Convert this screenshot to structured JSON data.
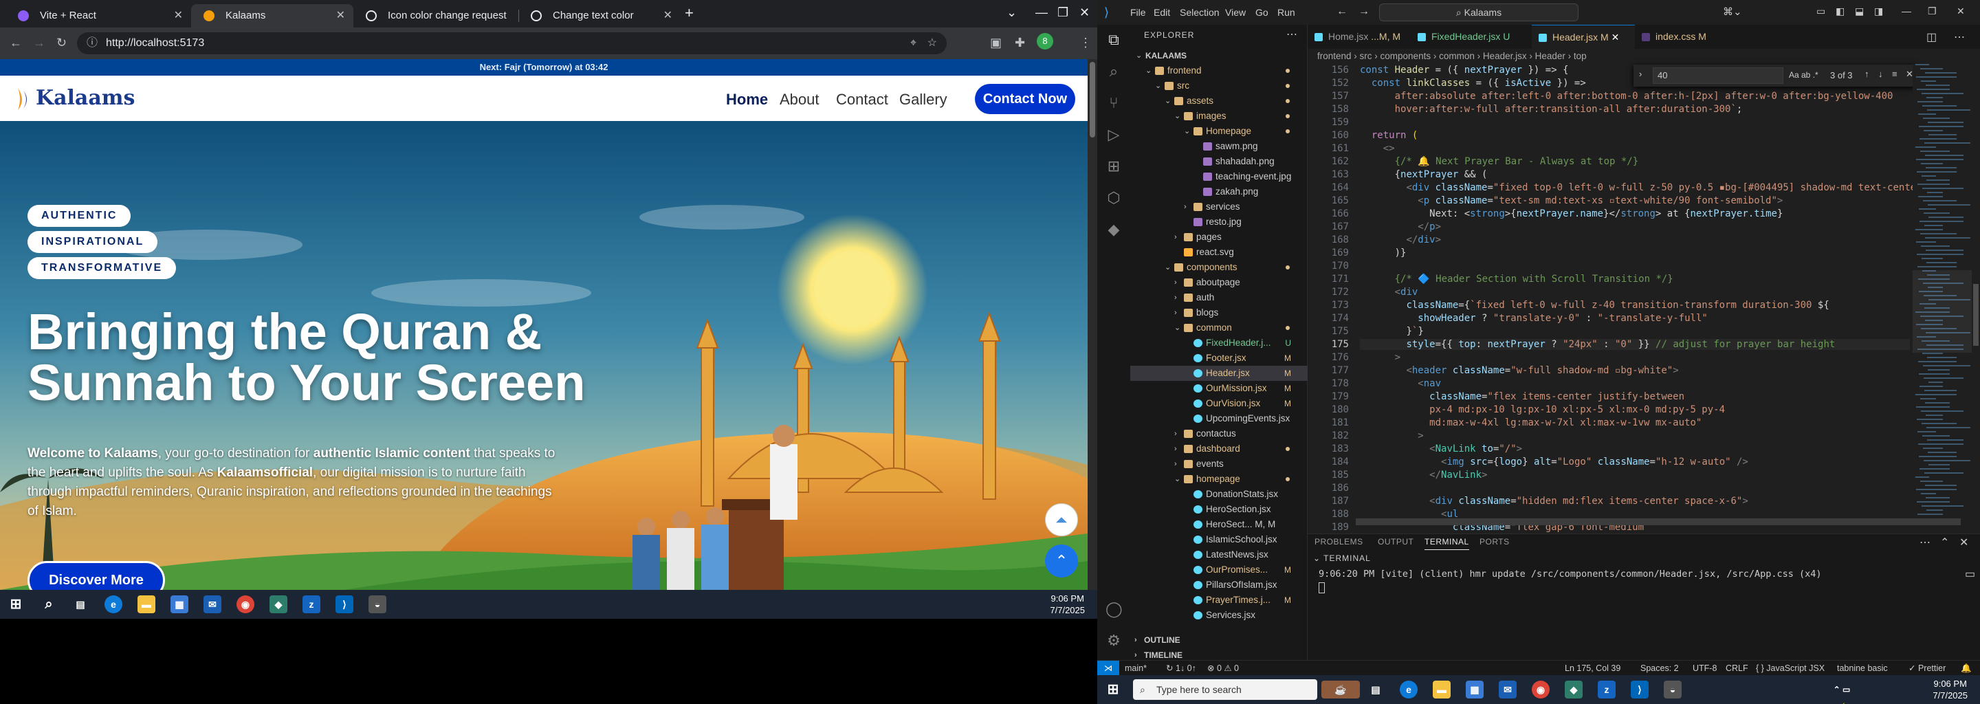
{
  "browser": {
    "tabs": [
      {
        "title": "Vite + React",
        "color": "#8b5cf6"
      },
      {
        "title": "Kalaams",
        "color": "#f59e0b"
      },
      {
        "title": "Icon color change request",
        "color": "#e8eaed"
      },
      {
        "title": "Change text color",
        "color": "#e8eaed"
      }
    ],
    "new_tab": "+",
    "url": "http://localhost:5173",
    "profile_initial": "8"
  },
  "site": {
    "prayer_bar": {
      "prefix": "Next: ",
      "name": "Fajr (Tomorrow)",
      "mid": " at ",
      "time": "03:42"
    },
    "logo": "Kalaams",
    "nav": [
      "Home",
      "About",
      "Contact",
      "Gallery"
    ],
    "contact_button": "Contact Now",
    "pills": [
      "AUTHENTIC",
      "INSPIRATIONAL",
      "TRANSFORMATIVE"
    ],
    "hero_title_1": "Bringing the Quran &",
    "hero_title_2": "Sunnah to Your Screen",
    "hero_desc": {
      "p1": "Welcome to Kalaams",
      "p2": ", your go-to destination for ",
      "p3": "authentic Islamic content",
      "p4": " that speaks to the heart and uplifts the soul. As ",
      "p5": "Kalaamsofficial",
      "p6": ", our digital mission is to nurture faith through impactful reminders, Quranic inspiration, and reflections grounded in the teachings of Islam."
    },
    "discover_button": "Discover More",
    "colors": {
      "primary": "#0033cc",
      "prayer_bar": "#004495"
    }
  },
  "taskbar_left": {
    "time": "9:06 PM",
    "date": "7/7/2025"
  },
  "vscode": {
    "menu": [
      "File",
      "Edit",
      "Selection",
      "View",
      "Go",
      "Run"
    ],
    "command_center": "Kalaams",
    "explorer_title": "EXPLORER",
    "tree": [
      {
        "name": "KALAAMS",
        "depth": 0,
        "type": "root",
        "status": ""
      },
      {
        "name": "frontend",
        "depth": 1,
        "type": "folder",
        "status": "dot"
      },
      {
        "name": "src",
        "depth": 2,
        "type": "folder",
        "status": "dot"
      },
      {
        "name": "assets",
        "depth": 3,
        "type": "folder",
        "status": "dot"
      },
      {
        "name": "images",
        "depth": 4,
        "type": "folder",
        "status": "dot"
      },
      {
        "name": "Homepage",
        "depth": 5,
        "type": "folder",
        "status": "dot"
      },
      {
        "name": "sawm.png",
        "depth": 6,
        "type": "image",
        "status": ""
      },
      {
        "name": "shahadah.png",
        "depth": 6,
        "type": "image",
        "status": ""
      },
      {
        "name": "teaching-event.jpg",
        "depth": 6,
        "type": "image",
        "status": ""
      },
      {
        "name": "zakah.png",
        "depth": 6,
        "type": "image",
        "status": ""
      },
      {
        "name": "services",
        "depth": 5,
        "type": "folder-c",
        "status": ""
      },
      {
        "name": "resto.jpg",
        "depth": 5,
        "type": "image",
        "status": ""
      },
      {
        "name": "pages",
        "depth": 4,
        "type": "folder-c",
        "status": ""
      },
      {
        "name": "react.svg",
        "depth": 4,
        "type": "svg",
        "status": ""
      },
      {
        "name": "components",
        "depth": 3,
        "type": "folder",
        "status": "dot"
      },
      {
        "name": "aboutpage",
        "depth": 4,
        "type": "folder-c",
        "status": ""
      },
      {
        "name": "auth",
        "depth": 4,
        "type": "folder-c",
        "status": ""
      },
      {
        "name": "blogs",
        "depth": 4,
        "type": "folder-c",
        "status": ""
      },
      {
        "name": "common",
        "depth": 4,
        "type": "folder",
        "status": "dot"
      },
      {
        "name": "FixedHeader.j...",
        "depth": 5,
        "type": "jsx",
        "status": "U"
      },
      {
        "name": "Footer.jsx",
        "depth": 5,
        "type": "jsx",
        "status": "M"
      },
      {
        "name": "Header.jsx",
        "depth": 5,
        "type": "jsx",
        "status": "M",
        "selected": true
      },
      {
        "name": "OurMission.jsx",
        "depth": 5,
        "type": "jsx",
        "status": "M"
      },
      {
        "name": "OurVision.jsx",
        "depth": 5,
        "type": "jsx",
        "status": "M"
      },
      {
        "name": "UpcomingEvents.jsx",
        "depth": 5,
        "type": "jsx",
        "status": ""
      },
      {
        "name": "contactus",
        "depth": 4,
        "type": "folder-c",
        "status": ""
      },
      {
        "name": "dashboard",
        "depth": 4,
        "type": "folder-c",
        "status": "dot"
      },
      {
        "name": "events",
        "depth": 4,
        "type": "folder-c",
        "status": ""
      },
      {
        "name": "homepage",
        "depth": 4,
        "type": "folder",
        "status": "dot"
      },
      {
        "name": "DonationStats.jsx",
        "depth": 5,
        "type": "jsx",
        "status": ""
      },
      {
        "name": "HeroSection.jsx",
        "depth": 5,
        "type": "jsx",
        "status": ""
      },
      {
        "name": "HeroSect... M, M",
        "depth": 5,
        "type": "jsx",
        "status": ""
      },
      {
        "name": "IslamicSchool.jsx",
        "depth": 5,
        "type": "jsx",
        "status": ""
      },
      {
        "name": "LatestNews.jsx",
        "depth": 5,
        "type": "jsx",
        "status": ""
      },
      {
        "name": "OurPromises...",
        "depth": 5,
        "type": "jsx",
        "status": "M"
      },
      {
        "name": "PillarsOfIslam.jsx",
        "depth": 5,
        "type": "jsx",
        "status": ""
      },
      {
        "name": "PrayerTimes.j...",
        "depth": 5,
        "type": "jsx",
        "status": "M"
      },
      {
        "name": "Services.jsx",
        "depth": 5,
        "type": "jsx",
        "status": ""
      }
    ],
    "outline": "OUTLINE",
    "timeline": "TIMELINE",
    "editor_tabs": [
      {
        "name": "Home.jsx",
        "status": "...M, M"
      },
      {
        "name": "FixedHeader.jsx",
        "status": "U"
      },
      {
        "name": "Header.jsx",
        "status": "M",
        "active": true
      },
      {
        "name": "index.css",
        "status": "M"
      }
    ],
    "breadcrumb": "frontend › src › components › common › Header.jsx › Header › top",
    "find": {
      "query": "40",
      "result": "3 of 3"
    },
    "code_lines": [
      {
        "n": "156",
        "html": "<span class='k'>const</span> <span class='f'>Header</span> <span class='o'>= ({</span> <span class='v'>nextPrayer</span> <span class='o'>}) =&gt; {</span>"
      },
      {
        "n": "152",
        "html": "  <span class='k'>const</span> <span class='f'>linkClasses</span> <span class='o'>= ({</span> <span class='v'>isActive</span> <span class='o'>}) =&gt;</span>"
      },
      {
        "n": "157",
        "html": "      <span class='s'>after:absolute after:left-0 after:bottom-0 after:h-[2px] after:w-0 after:bg-yellow-400</span>"
      },
      {
        "n": "158",
        "html": "      <span class='s'>hover:after:w-full after:transition-all after:duration-300`</span><span class='o'>;</span>"
      },
      {
        "n": "159",
        "html": ""
      },
      {
        "n": "160",
        "html": "  <span class='p'>return</span> <span class='y'>(</span>"
      },
      {
        "n": "161",
        "html": "    <span class='g'>&lt;&gt;</span>"
      },
      {
        "n": "162",
        "html": "      <span class='c'>{/* 🔔 Next Prayer Bar - Always at top */}</span>"
      },
      {
        "n": "163",
        "html": "      <span class='o'>{</span><span class='v'>nextPrayer</span> <span class='o'>&amp;&amp; (</span>"
      },
      {
        "n": "164",
        "html": "        <span class='g'>&lt;</span><span class='k'>div</span> <span class='a'>className</span><span class='o'>=</span><span class='s'>\"fixed top-0 left-0 w-full z-50 py-0.5 ▪bg-[#004495] shadow-md text-center\"</span><span class='g'>&gt;</span>"
      },
      {
        "n": "165",
        "html": "          <span class='g'>&lt;</span><span class='k'>p</span> <span class='a'>className</span><span class='o'>=</span><span class='s'>\"text-sm md:text-xs ▫text-white/90 font-semibold\"</span><span class='g'>&gt;</span>"
      },
      {
        "n": "166",
        "html": "            <span class='o'>Next: &lt;</span><span class='k'>strong</span><span class='o'>&gt;{</span><span class='v'>nextPrayer.name</span><span class='o'>}&lt;/</span><span class='k'>strong</span><span class='o'>&gt; at {</span><span class='v'>nextPrayer.time</span><span class='o'>}</span>"
      },
      {
        "n": "167",
        "html": "          <span class='g'>&lt;/</span><span class='k'>p</span><span class='g'>&gt;</span>"
      },
      {
        "n": "168",
        "html": "        <span class='g'>&lt;/</span><span class='k'>div</span><span class='g'>&gt;</span>"
      },
      {
        "n": "169",
        "html": "      <span class='o'>)}</span>"
      },
      {
        "n": "170",
        "html": ""
      },
      {
        "n": "171",
        "html": "      <span class='c'>{/* 🔷 Header Section with Scroll Transition */}</span>"
      },
      {
        "n": "172",
        "html": "      <span class='g'>&lt;</span><span class='k'>div</span>"
      },
      {
        "n": "173",
        "html": "        <span class='a'>className</span><span class='o'>={</span><span class='s'>`fixed left-0 w-full z-40 transition-transform duration-300 </span><span class='o'>${</span>"
      },
      {
        "n": "174",
        "html": "          <span class='v'>showHeader</span> <span class='o'>?</span> <span class='s'>\"translate-y-0\"</span> <span class='o'>:</span> <span class='s'>\"-translate-y-full\"</span>"
      },
      {
        "n": "175",
        "html": "        <span class='o'>}</span><span class='s'>`</span><span class='o'>}</span>"
      },
      {
        "n": "175",
        "html": "        <span class='a'>style</span><span class='o'>={{</span> <span class='v'>top</span><span class='o'>:</span> <span class='v'>nextPrayer</span> <span class='o'>?</span> <span class='s'>\"24px\"</span> <span class='o'>:</span> <span class='s'>\"0\"</span> <span class='o'>}}</span> <span class='c'>// adjust for prayer bar height</span>",
        "cur": true
      },
      {
        "n": "176",
        "html": "      <span class='g'>&gt;</span>"
      },
      {
        "n": "177",
        "html": "        <span class='g'>&lt;</span><span class='k'>header</span> <span class='a'>className</span><span class='o'>=</span><span class='s'>\"w-full shadow-md ▫bg-white\"</span><span class='g'>&gt;</span>"
      },
      {
        "n": "178",
        "html": "          <span class='g'>&lt;</span><span class='k'>nav</span>"
      },
      {
        "n": "179",
        "html": "            <span class='a'>className</span><span class='o'>=</span><span class='s'>\"flex items-center justify-between</span>"
      },
      {
        "n": "180",
        "html": "            <span class='s'>px-4 md:px-10 lg:px-10 xl:px-5 xl:mx-0 md:py-5 py-4</span>"
      },
      {
        "n": "181",
        "html": "            <span class='s'>md:max-w-4xl lg:max-w-7xl xl:max-w-1vw mx-auto\"</span>"
      },
      {
        "n": "182",
        "html": "          <span class='g'>&gt;</span>"
      },
      {
        "n": "183",
        "html": "            <span class='g'>&lt;</span><span class='t'>NavLink</span> <span class='a'>to</span><span class='o'>=</span><span class='s'>\"/\"</span><span class='g'>&gt;</span>"
      },
      {
        "n": "184",
        "html": "              <span class='g'>&lt;</span><span class='k'>img</span> <span class='a'>src</span><span class='o'>={</span><span class='v'>logo</span><span class='o'>}</span> <span class='a'>alt</span><span class='o'>=</span><span class='s'>\"Logo\"</span> <span class='a'>className</span><span class='o'>=</span><span class='s'>\"h-12 w-auto\"</span> <span class='g'>/&gt;</span>"
      },
      {
        "n": "185",
        "html": "            <span class='g'>&lt;/</span><span class='t'>NavLink</span><span class='g'>&gt;</span>"
      },
      {
        "n": "186",
        "html": ""
      },
      {
        "n": "187",
        "html": "            <span class='g'>&lt;</span><span class='k'>div</span> <span class='a'>className</span><span class='o'>=</span><span class='s'>\"hidden md:flex items-center space-x-6\"</span><span class='g'>&gt;</span>"
      },
      {
        "n": "188",
        "html": "              <span class='g'>&lt;</span><span class='k'>ul</span>"
      },
      {
        "n": "189",
        "html": "                <span class='a'>className</span><span class='o'>=</span><span class='s'>\"flex gap-6 font-medium</span>"
      }
    ],
    "panel_tabs": [
      "PROBLEMS",
      "OUTPUT",
      "TERMINAL",
      "PORTS"
    ],
    "terminal_title": "TERMINAL",
    "terminal_line": "9:06:20 PM [vite] (client) hmr update /src/components/common/Header.jsx, /src/App.css (x4)",
    "status": {
      "branch": "main*",
      "sync": "↻ 1↓ 0↑",
      "problems": "⊗ 0 ⚠ 0",
      "position": "Ln 175, Col 39",
      "spaces": "Spaces: 2",
      "encoding": "UTF-8",
      "eol": "CRLF",
      "language": "{ } JavaScript JSX",
      "tabnine": "tabnine basic",
      "prettier": "✓ Prettier"
    }
  },
  "taskbar_right": {
    "search": "Type here to search",
    "time": "9:06 PM",
    "date": "7/7/2025"
  }
}
